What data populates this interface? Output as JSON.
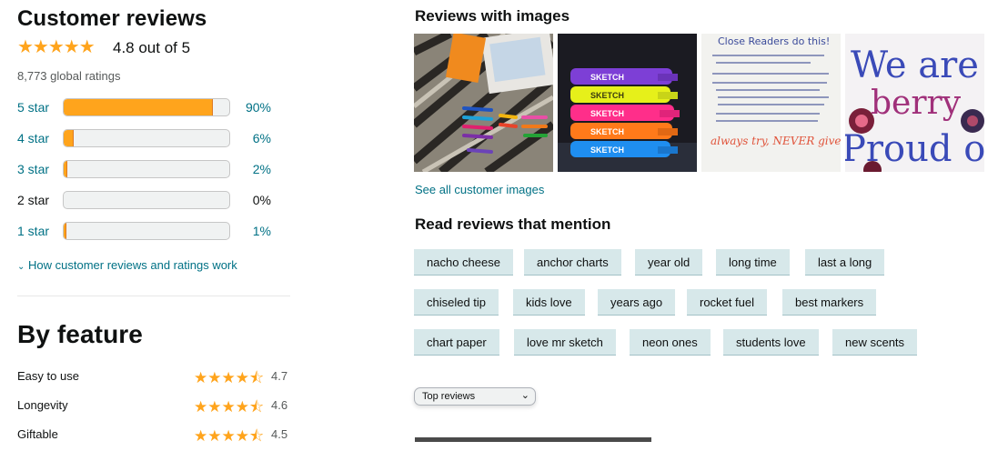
{
  "summary": {
    "title": "Customer reviews",
    "stars": "★★★★★",
    "rating_text": "4.8 out of 5",
    "global_ratings": "8,773 global ratings",
    "how_link": "How customer reviews and ratings work"
  },
  "histogram": [
    {
      "label": "5 star",
      "percent_text": "90%",
      "fraction": 0.9,
      "linked": true
    },
    {
      "label": "4 star",
      "percent_text": "6%",
      "fraction": 0.06,
      "linked": true
    },
    {
      "label": "3 star",
      "percent_text": "2%",
      "fraction": 0.02,
      "linked": true
    },
    {
      "label": "2 star",
      "percent_text": "0%",
      "fraction": 0.0,
      "linked": false
    },
    {
      "label": "1 star",
      "percent_text": "1%",
      "fraction": 0.01,
      "linked": true
    }
  ],
  "by_feature": {
    "title": "By feature",
    "items": [
      {
        "name": "Easy to use",
        "value": "4.7",
        "stars": "★★★★⯪"
      },
      {
        "name": "Longevity",
        "value": "4.6",
        "stars": "★★★★⯪"
      },
      {
        "name": "Giftable",
        "value": "4.5",
        "stars": "★★★★⯪"
      }
    ]
  },
  "images": {
    "title": "Reviews with images",
    "see_all": "See all customer images",
    "thumbs": [
      {
        "desc": "markers on rug"
      },
      {
        "desc": "neon markers in packaging"
      },
      {
        "desc": "Close Readers do this!",
        "heading": "Close Readers do this!",
        "footer": "always try, NEVER give up!"
      },
      {
        "desc": "We are berry proud of you",
        "text": "We are berry Proud of You"
      }
    ]
  },
  "mentions": {
    "title": "Read reviews that mention",
    "rows": [
      [
        "nacho cheese",
        "anchor charts",
        "year old",
        "long time",
        "last a long"
      ],
      [
        "chiseled tip",
        "kids love",
        "years ago",
        "rocket fuel",
        "best markers"
      ],
      [
        "chart paper",
        "love mr sketch",
        "neon ones",
        "students love",
        "new scents"
      ]
    ]
  },
  "sort": {
    "selected": "Top reviews"
  },
  "colors": {
    "star": "#ffa41c",
    "link": "#007185",
    "chip": "#d7e8ea"
  }
}
